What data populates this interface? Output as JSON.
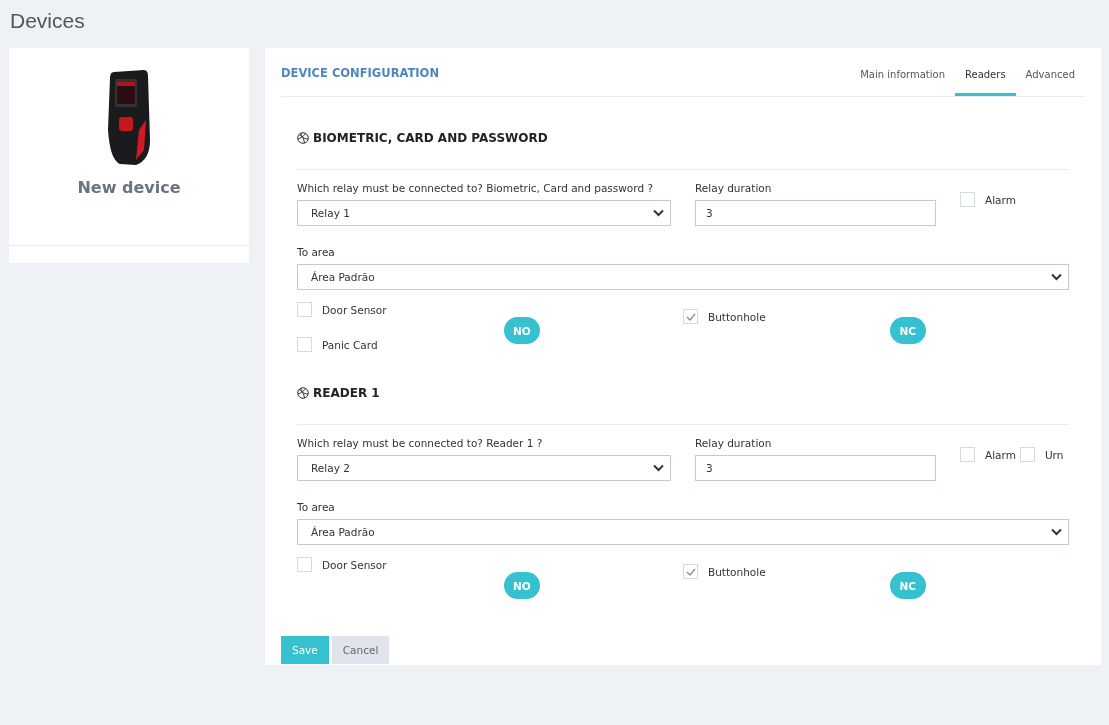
{
  "page_title": "Devices",
  "device": {
    "name": "New device"
  },
  "config": {
    "title": "DEVICE CONFIGURATION",
    "tabs": [
      {
        "label": "Main information",
        "selected": false
      },
      {
        "label": "Readers",
        "selected": true
      },
      {
        "label": "Advanced",
        "selected": false
      }
    ],
    "sections": [
      {
        "title": "BIOMETRIC, CARD AND PASSWORD",
        "relay_label": "Which relay must be connected to? Biometric, Card and password ?",
        "relay_value": "Relay 1",
        "duration_label": "Relay duration",
        "duration_value": "3",
        "flags": [
          {
            "label": "Alarm",
            "checked": false
          }
        ],
        "area_label": "To area",
        "area_value": "Área Padrão",
        "left_options": [
          {
            "label": "Door Sensor",
            "checked": false
          },
          {
            "label": "Panic Card",
            "checked": false
          }
        ],
        "left_toggle": "NO",
        "right_options": [
          {
            "label": "Buttonhole",
            "checked": true
          }
        ],
        "right_toggle": "NC"
      },
      {
        "title": "READER 1",
        "relay_label": "Which relay must be connected to? Reader 1 ?",
        "relay_value": "Relay 2",
        "duration_label": "Relay duration",
        "duration_value": "3",
        "flags": [
          {
            "label": "Alarm",
            "checked": false
          },
          {
            "label": "Urn",
            "checked": false
          }
        ],
        "area_label": "To area",
        "area_value": "Área Padrão",
        "left_options": [
          {
            "label": "Door Sensor",
            "checked": false
          }
        ],
        "left_toggle": "NO",
        "right_options": [
          {
            "label": "Buttonhole",
            "checked": true
          }
        ],
        "right_toggle": "NC"
      }
    ],
    "buttons": [
      {
        "label": "Save",
        "kind": "primary"
      },
      {
        "label": "Cancel",
        "kind": "secondary"
      }
    ]
  }
}
